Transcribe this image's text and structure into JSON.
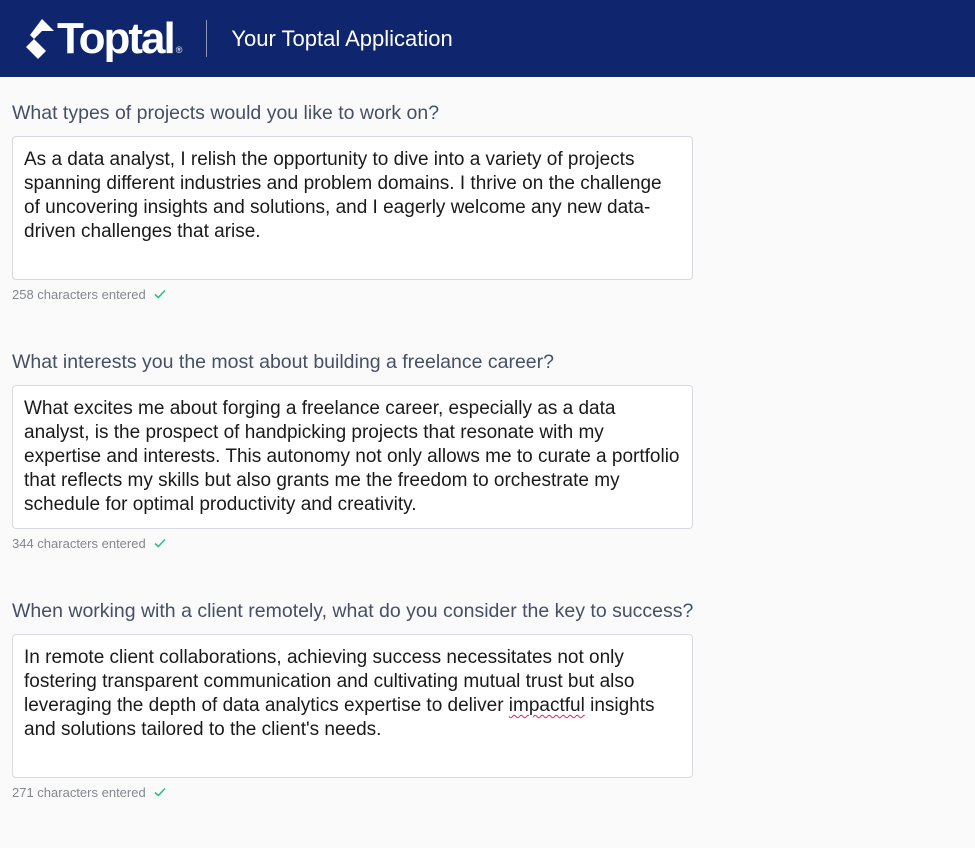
{
  "header": {
    "logo_text": "Toptal",
    "logo_reg": "®",
    "title": "Your Toptal Application"
  },
  "questions": [
    {
      "prompt": "What types of projects would you like to work on?",
      "answer": "As a data analyst, I relish the opportunity to dive into a variety of projects spanning different industries and problem domains. I thrive on the challenge of uncovering insights and solutions, and I eagerly welcome any new data-driven challenges that arise.",
      "count_label": "258 characters entered"
    },
    {
      "prompt": "What interests you the most about building a freelance career?",
      "answer": "What excites me about forging a freelance career, especially as a data analyst, is the prospect of handpicking projects that resonate with my expertise and interests. This autonomy not only allows me to curate a portfolio that reflects my skills but also grants me the freedom to orchestrate my schedule for optimal productivity and creativity.",
      "count_label": "344 characters entered"
    },
    {
      "prompt": "When working with a client remotely, what do you consider the key to success?",
      "answer_before": "In remote client collaborations, achieving success necessitates not only fostering transparent communication and cultivating mutual trust but also leveraging the depth of data analytics expertise to deliver ",
      "answer_flagged": "impactful",
      "answer_after": " insights and solutions tailored to the client's needs.",
      "count_label": "271 characters entered"
    }
  ],
  "colors": {
    "header_bg": "#0f256e",
    "check": "#2fbd8b",
    "spellcheck": "#e0245e"
  }
}
